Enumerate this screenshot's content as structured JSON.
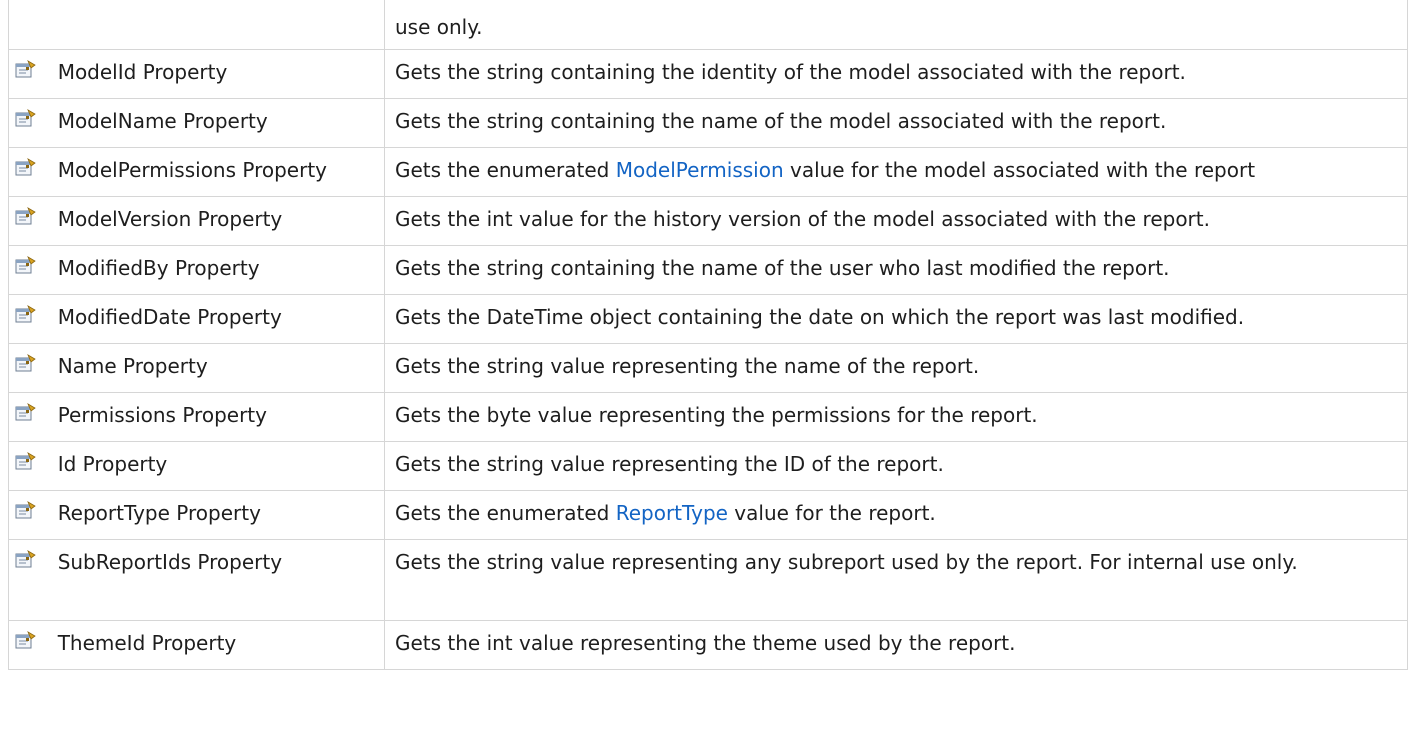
{
  "continuation_text": "use only.",
  "rows": [
    {
      "icon": "property-icon",
      "name": "ModelId Property",
      "desc_before": "Gets the string containing the identity of the model associated with the report.",
      "link": "",
      "desc_after": ""
    },
    {
      "icon": "property-icon",
      "name": "ModelName Property",
      "desc_before": "Gets the string containing the name of the model associated with the report.",
      "link": "",
      "desc_after": ""
    },
    {
      "icon": "property-icon",
      "name": "ModelPermissions Property",
      "desc_before": "Gets the enumerated ",
      "link": "ModelPermission",
      "desc_after": " value for the model associated with the report"
    },
    {
      "icon": "property-icon",
      "name": "ModelVersion Property",
      "desc_before": "Gets the int value for the history version of the model associated with the report.",
      "link": "",
      "desc_after": ""
    },
    {
      "icon": "property-icon",
      "name": "ModifiedBy Property",
      "desc_before": "Gets the string containing the name of the user who last modified the report.",
      "link": "",
      "desc_after": ""
    },
    {
      "icon": "property-icon",
      "name": "ModifiedDate Property",
      "desc_before": "Gets the DateTime object containing the date on which the report was last modified.",
      "link": "",
      "desc_after": ""
    },
    {
      "icon": "property-icon",
      "name": "Name Property",
      "desc_before": "Gets the string value representing the name of the report.",
      "link": "",
      "desc_after": ""
    },
    {
      "icon": "property-icon",
      "name": "Permissions Property",
      "desc_before": "Gets the byte value representing the permissions for the report.",
      "link": "",
      "desc_after": ""
    },
    {
      "icon": "property-icon",
      "name": "Id Property",
      "desc_before": "Gets the string value representing the ID of the report.",
      "link": "",
      "desc_after": ""
    },
    {
      "icon": "property-icon",
      "name": "ReportType Property",
      "desc_before": "Gets the enumerated ",
      "link": "ReportType",
      "desc_after": " value for the report."
    },
    {
      "icon": "property-icon",
      "name": "SubReportIds Property",
      "desc_before": "Gets the string value representing any subreport used by the report. For internal use only.",
      "link": "",
      "desc_after": ""
    },
    {
      "icon": "property-icon",
      "name": "ThemeId Property",
      "desc_before": "Gets the int value representing the theme used by the report.",
      "link": "",
      "desc_after": ""
    }
  ],
  "colors": {
    "link": "#1364c4",
    "border": "#d6d6d6",
    "text": "#1e1e1e"
  }
}
